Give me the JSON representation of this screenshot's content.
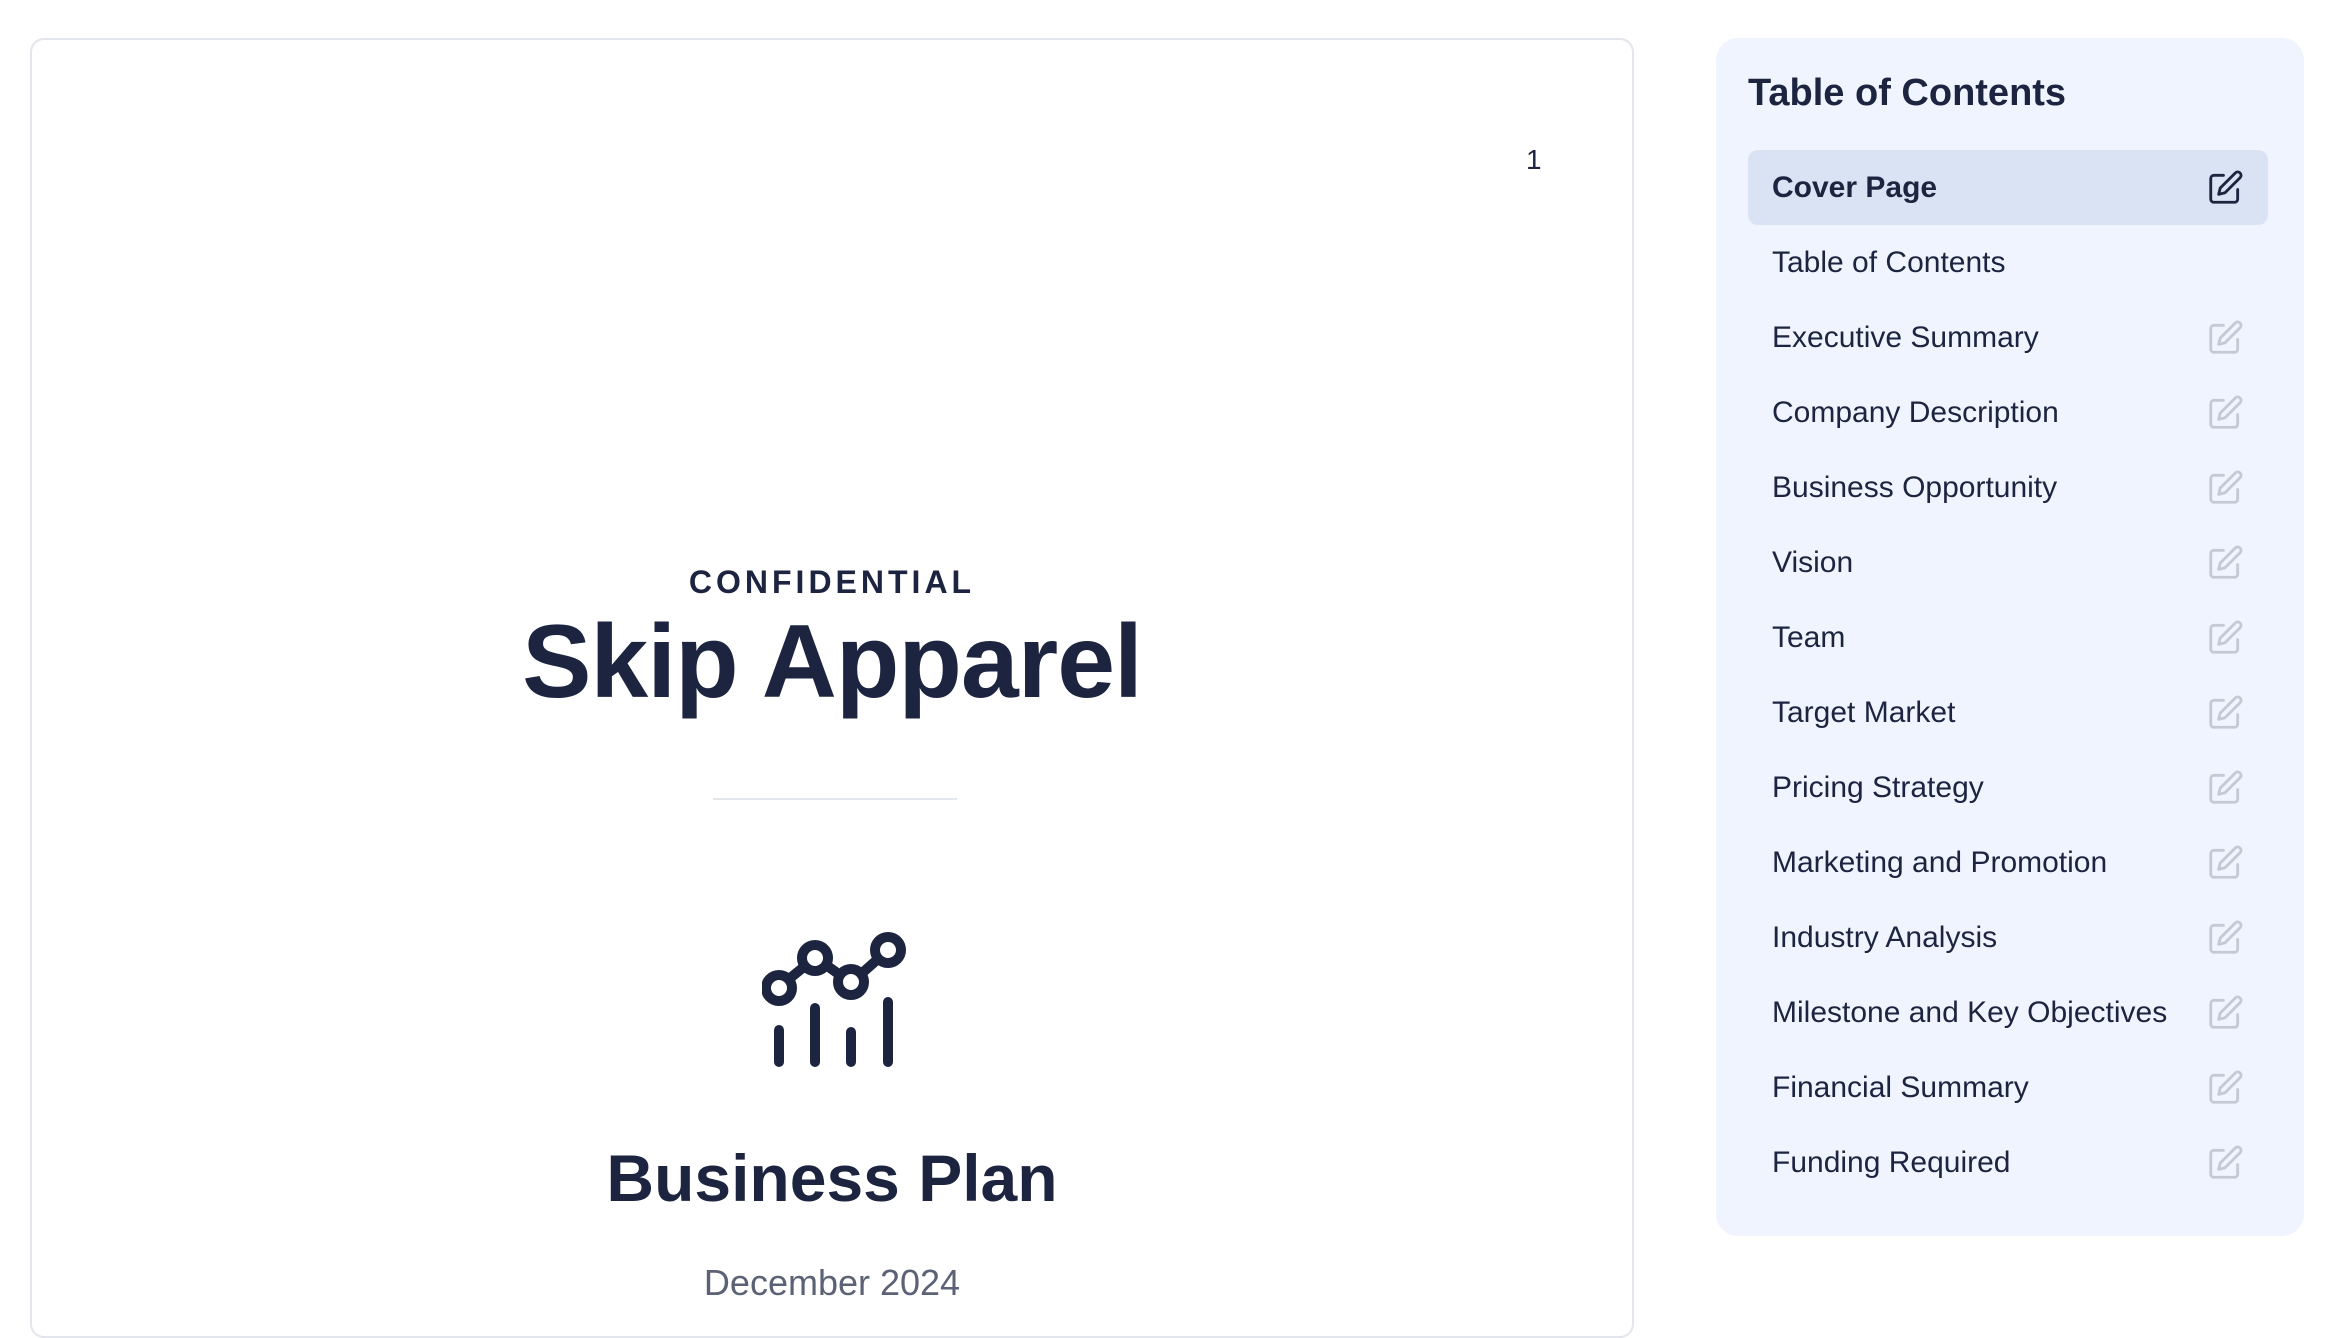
{
  "document": {
    "page_number": "1",
    "confidential_label": "CONFIDENTIAL",
    "company_name": "Skip Apparel",
    "doc_title": "Business Plan",
    "date": "December 2024",
    "icon": "chart-growth-icon"
  },
  "toc": {
    "heading": "Table of Contents",
    "active_index": 0,
    "items": [
      {
        "label": "Cover Page",
        "editable": true
      },
      {
        "label": "Table of Contents",
        "editable": false
      },
      {
        "label": "Executive Summary",
        "editable": true
      },
      {
        "label": "Company Description",
        "editable": true
      },
      {
        "label": "Business Opportunity",
        "editable": true
      },
      {
        "label": "Vision",
        "editable": true
      },
      {
        "label": "Team",
        "editable": true
      },
      {
        "label": "Target Market",
        "editable": true
      },
      {
        "label": "Pricing Strategy",
        "editable": true
      },
      {
        "label": "Marketing and Promotion",
        "editable": true
      },
      {
        "label": "Industry Analysis",
        "editable": true
      },
      {
        "label": "Milestone and Key Objectives",
        "editable": true
      },
      {
        "label": "Financial Summary",
        "editable": true
      },
      {
        "label": "Funding Required",
        "editable": true
      }
    ]
  },
  "colors": {
    "text": "#1c2440",
    "muted_text": "#5b6275",
    "panel_bg": "#eff4fe",
    "active_bg": "#d9e3f4",
    "edit_icon_active": "#1c2440",
    "edit_icon_inactive": "#c4c9d6"
  }
}
